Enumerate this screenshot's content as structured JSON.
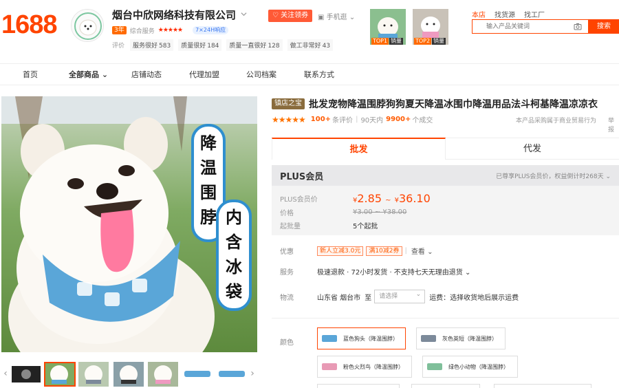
{
  "header": {
    "logo": "1688",
    "shop_name": "烟台中欣网络科技有限公司",
    "year_badge": "3年",
    "service_label": "综合服务",
    "service_stars": "★★★★★",
    "pill": "7×24H响应",
    "scores": [
      {
        "label": "评价",
        "value": ""
      },
      {
        "label": "服务很好",
        "value": "583"
      },
      {
        "label": "质量很好",
        "value": "184"
      },
      {
        "label": "质量一直很好",
        "value": "128"
      },
      {
        "label": "做工非常好",
        "value": "43"
      }
    ],
    "follow_label": "关注领券",
    "mobile_label": "手机逛",
    "top_pics": [
      {
        "tag": "TOP1",
        "tag2": "销量"
      },
      {
        "tag": "TOP2",
        "tag2": "销量"
      }
    ],
    "search_scopes": [
      "本店",
      "找货源",
      "找工厂"
    ],
    "search_placeholder": "输入产品关键词",
    "search_button": "搜索"
  },
  "nav": {
    "items": [
      "首页",
      "全部商品",
      "店铺动态",
      "代理加盟",
      "公司档案",
      "联系方式"
    ]
  },
  "product": {
    "shop_tag": "镇店之宝",
    "title": "批发宠物降温围脖狗狗夏天降温冰围巾降温用品法斗柯基降温凉凉衣",
    "rating_stars": "★★★★★",
    "review_count": "100+",
    "review_label": "条评价",
    "sold_prefix": "90天内",
    "sold_count": "9900+",
    "sold_suffix": "个成交",
    "note": "本产品采购属于商业贸易行为",
    "note2": "举报",
    "mode_tabs": [
      "批发",
      "代发"
    ],
    "image_text": [
      "降",
      "温",
      "围",
      "脖",
      "内",
      "含",
      "冰",
      "袋"
    ]
  },
  "pricing": {
    "plus_title": "PLUS会员",
    "plus_note": "已尊享PLUS会员价，权益倒计时268天",
    "plus_price_label": "PLUS会员价",
    "currency": "¥",
    "price_low": "2.85",
    "price_sep": "~",
    "price_high": "36.10",
    "price_label": "价格",
    "orig_price": "¥3.00 ~ ¥38.00",
    "moq_label": "起批量",
    "moq_value": "5个起批"
  },
  "details": {
    "promo_label": "优惠",
    "coupons": [
      "新人立减3.0元",
      "满10减2券"
    ],
    "look_label": "查看",
    "service_label": "服务",
    "service_text": "极速退款 · 72小时发货 · 不支持七天无理由退货",
    "logistics_label": "物流",
    "origin": "山东省 烟台市",
    "to_label": "至",
    "dest_placeholder": "请选择",
    "freight": "运费：选择收货地后展示运费",
    "color_label": "颜色",
    "skus": [
      {
        "name": "蓝色狗头（降温围脖）",
        "swatch": "#5aa6d8"
      },
      {
        "name": "灰色英短（降温围脖）",
        "swatch": "#7c8a9a"
      },
      {
        "name": "粉色火烈鸟（降温围脖）",
        "swatch": "#e89ab5"
      },
      {
        "name": "绿色小动物（降温围脖）",
        "swatch": "#7fbf9a"
      }
    ]
  },
  "colors": {
    "brand": "#ff4400",
    "follow": "#ff5a36",
    "shop_tag": "#8a6c3d"
  }
}
